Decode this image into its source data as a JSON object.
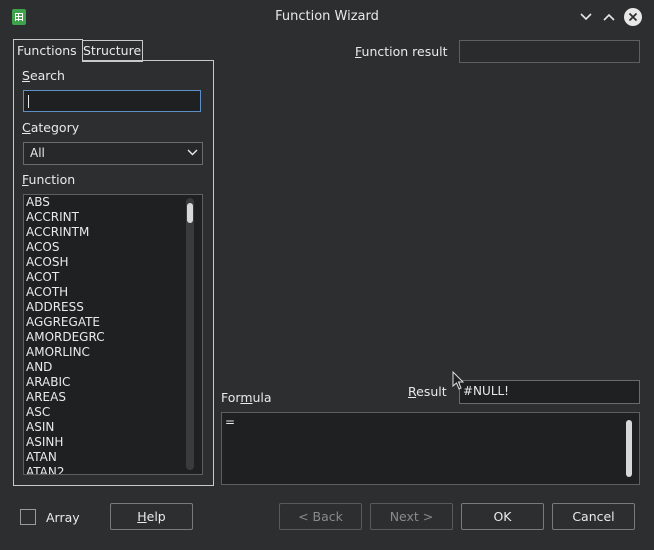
{
  "window": {
    "title": "Function Wizard"
  },
  "tabs": [
    {
      "label": "Functions"
    },
    {
      "label": "Structure"
    }
  ],
  "search": {
    "label": "Search",
    "value": ""
  },
  "category": {
    "label": "Category",
    "value": "All"
  },
  "function_list": {
    "label": "Function",
    "items": [
      "ABS",
      "ACCRINT",
      "ACCRINTM",
      "ACOS",
      "ACOSH",
      "ACOT",
      "ACOTH",
      "ADDRESS",
      "AGGREGATE",
      "AMORDEGRC",
      "AMORLINC",
      "AND",
      "ARABIC",
      "AREAS",
      "ASC",
      "ASIN",
      "ASINH",
      "ATAN",
      "ATAN2"
    ]
  },
  "function_result": {
    "label": "Function result",
    "value": ""
  },
  "result": {
    "label": "Result",
    "value": "#NULL!"
  },
  "formula": {
    "label": "Formula",
    "value": "="
  },
  "array": {
    "label": "Array",
    "checked": false
  },
  "buttons": {
    "help": "Help",
    "back": "< Back",
    "next": "Next >",
    "ok": "OK",
    "cancel": "Cancel"
  },
  "icons": {
    "app": "calc-icon",
    "minimize": "chevron-down-icon",
    "maximize": "chevron-up-icon",
    "close": "close-icon"
  },
  "colors": {
    "background": "#2d2e30",
    "field": "#1f2022",
    "focus": "#5c8fc6",
    "app_icon": "#3fa34d"
  }
}
